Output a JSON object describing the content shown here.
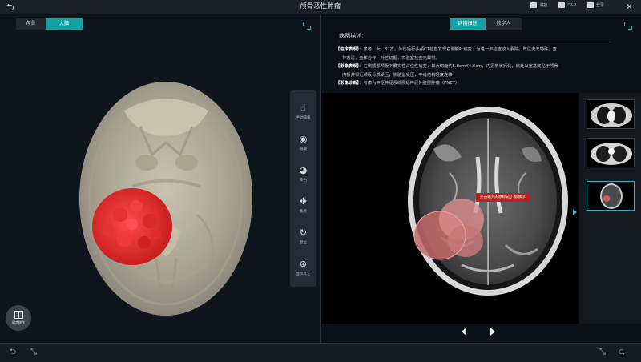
{
  "header": {
    "title": "颅骨恶性肿瘤",
    "tools": [
      {
        "icon": "present-icon",
        "label": "讲授"
      },
      {
        "icon": "dnp-icon",
        "label": "D&P"
      },
      {
        "icon": "login-icon",
        "label": "登录"
      }
    ]
  },
  "left_panel": {
    "tabs": [
      "颅骨",
      "大脑"
    ],
    "active_tab": "大脑",
    "toolbar": [
      {
        "icon": "hand-icon",
        "label": "手动隔离"
      },
      {
        "icon": "eye-icon",
        "label": "隐藏"
      },
      {
        "icon": "palette-icon",
        "label": "染色"
      },
      {
        "icon": "point-icon",
        "label": "焦点"
      },
      {
        "icon": "reset-icon",
        "label": "复位"
      },
      {
        "icon": "display-icon",
        "label": "显示其它"
      }
    ],
    "sync_label": "同步操作"
  },
  "right_panel": {
    "tabs": [
      "病例描述",
      "数字人"
    ],
    "active_tab": "病例描述",
    "desc_title": "病例描述：",
    "desc_rows": [
      {
        "tag": "【临床表现】",
        "text": "：患者，女，37岁。外伤后行头颅CT检查发现右侧额叶病变，为进一步检查收入我院。既往史无特殊。查"
      },
      {
        "tag": "",
        "text": "神志清，查体合作，对答切题，实验室检查无异常。"
      },
      {
        "tag": "【影像表现】",
        "text": "：右侧额部颅板下囊实性占位性病变，其大切面约5.8cmX4.8cm，内见条状钙化，病灶以宽基底贴于颅骨"
      },
      {
        "tag": "",
        "text": "内板并邻近颅板骨质受压，侧脑室受压，中线结构轻度左移"
      },
      {
        "tag": "【影像诊断】",
        "text": "：考虑为中枢神经系统原始神经外胚层肿瘤（PNET）"
      }
    ],
    "annotation_label": "点击输入的原标记了 影像示",
    "thumbnails": [
      "chest-ct-1",
      "chest-ct-2",
      "brain-mri"
    ],
    "selected_thumbnail": "brain-mri"
  },
  "colors": {
    "accent": "#0fa3a6",
    "tumor": "#e23636",
    "annotation": "#b32525"
  }
}
